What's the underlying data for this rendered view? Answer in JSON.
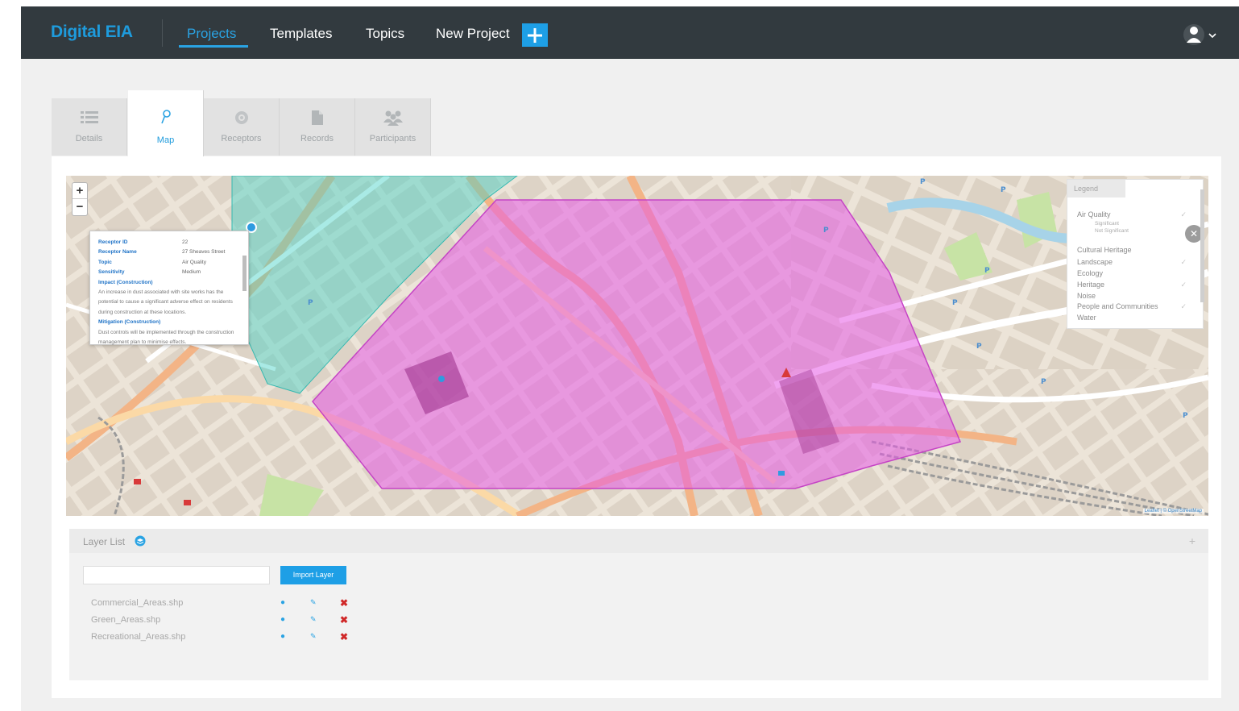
{
  "header": {
    "brand": "Digital EIA",
    "nav": [
      {
        "label": "Projects",
        "active": true
      },
      {
        "label": "Templates",
        "active": false
      },
      {
        "label": "Topics",
        "active": false
      },
      {
        "label": "New Project",
        "active": false
      }
    ],
    "add_icon": "plus-icon",
    "user_icon": "user-icon",
    "accent_color": "#1e9bdc"
  },
  "tabs": [
    {
      "label": "Details",
      "icon": "list-icon",
      "active": false
    },
    {
      "label": "Map",
      "icon": "pin-icon",
      "active": true
    },
    {
      "label": "Receptors",
      "icon": "target-icon",
      "active": false
    },
    {
      "label": "Records",
      "icon": "document-icon",
      "active": false
    },
    {
      "label": "Participants",
      "icon": "people-icon",
      "active": false
    }
  ],
  "map": {
    "zoom_in": "+",
    "zoom_out": "−",
    "popup": {
      "fields": [
        {
          "key": "Receptor ID",
          "value": "22"
        },
        {
          "key": "Receptor Name",
          "value": "27 Sheaves Street"
        },
        {
          "key": "Topic",
          "value": "Air Quality"
        },
        {
          "key": "Sensitivity",
          "value": "Medium"
        }
      ],
      "impact_heading": "Impact (Construction)",
      "impact_text": "An increase in dust associated with site works has the potential to cause a significant adverse effect on residents during construction at these locations.",
      "mitigation_heading": "Mitigation (Construction)",
      "mitigation_text": "Dust controls will be implemented through the construction management plan to minimise effects."
    },
    "legend": {
      "title": "Legend",
      "items": [
        {
          "label": "Air Quality",
          "subs": [
            "Significant",
            "Not Significant"
          ]
        },
        {
          "label": "Cultural Heritage",
          "subs": []
        },
        {
          "label": "Landscape",
          "subs": []
        },
        {
          "label": "Ecology",
          "subs": []
        },
        {
          "label": "Heritage",
          "subs": []
        },
        {
          "label": "Noise",
          "subs": []
        },
        {
          "label": "People and Communities",
          "subs": []
        },
        {
          "label": "Water",
          "subs": []
        }
      ],
      "check": "✓",
      "close": "✕"
    },
    "attribution": "Leaflet | © OpenStreetMap"
  },
  "layers": {
    "title": "Layer List",
    "layers_icon": "stack-icon",
    "expand": "+",
    "input_placeholder": "",
    "import_label": "Import Layer",
    "rows": [
      {
        "name": "Commercial_Areas.shp"
      },
      {
        "name": "Green_Areas.shp"
      },
      {
        "name": "Recreational_Areas.shp"
      }
    ],
    "visibility_icon": "eye-icon",
    "edit_icon": "pencil-icon",
    "delete_icon": "close-icon",
    "delete_glyph": "✖"
  }
}
